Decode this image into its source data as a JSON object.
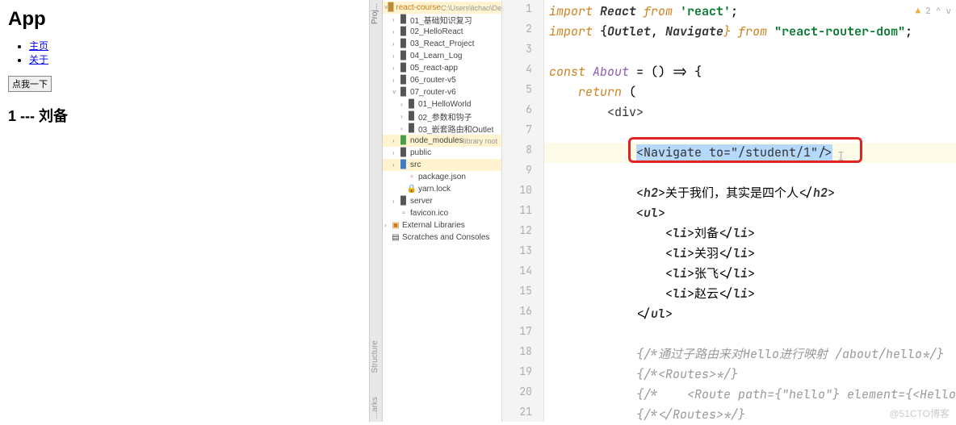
{
  "browser": {
    "title": "App",
    "nav": [
      "主页",
      "关于"
    ],
    "button": "点我一下",
    "content": "1 --- 刘备"
  },
  "ideTabs": {
    "top": "Proj...",
    "structure": "Structure",
    "bookmarks": "...arks"
  },
  "tree": [
    {
      "d": 0,
      "arrow": "v",
      "icon": "folder",
      "cls": "folder-icon",
      "label": "react-course",
      "suffix": " C:\\Users\\lichao\\De",
      "labelCls": "orange-txt",
      "selected": true
    },
    {
      "d": 1,
      "arrow": ">",
      "icon": "folder",
      "cls": "folder-dark",
      "label": "01_基础知识复习"
    },
    {
      "d": 1,
      "arrow": ">",
      "icon": "folder",
      "cls": "folder-dark",
      "label": "02_HelloReact"
    },
    {
      "d": 1,
      "arrow": ">",
      "icon": "folder",
      "cls": "folder-dark",
      "label": "03_React_Project"
    },
    {
      "d": 1,
      "arrow": ">",
      "icon": "folder",
      "cls": "folder-dark",
      "label": "04_Learn_Log"
    },
    {
      "d": 1,
      "arrow": ">",
      "icon": "folder",
      "cls": "folder-dark",
      "label": "05_react-app"
    },
    {
      "d": 1,
      "arrow": ">",
      "icon": "folder",
      "cls": "folder-dark",
      "label": "06_router-v5"
    },
    {
      "d": 1,
      "arrow": "v",
      "icon": "folder",
      "cls": "folder-dark",
      "label": "07_router-v6"
    },
    {
      "d": 2,
      "arrow": ">",
      "icon": "folder",
      "cls": "folder-dark",
      "label": "01_HelloWorld"
    },
    {
      "d": 2,
      "arrow": ">",
      "icon": "folder",
      "cls": "folder-dark",
      "label": "02_参数和钩子"
    },
    {
      "d": 2,
      "arrow": ">",
      "icon": "folder",
      "cls": "folder-dark",
      "label": "03_嵌套路由和Outlet"
    },
    {
      "d": 1,
      "arrow": ">",
      "icon": "folder",
      "cls": "green-icon",
      "label": "node_modules",
      "suffix": " library root",
      "selected": true,
      "labelCls": ""
    },
    {
      "d": 1,
      "arrow": ">",
      "icon": "folder",
      "cls": "folder-dark",
      "label": "public"
    },
    {
      "d": 1,
      "arrow": ">",
      "icon": "folder",
      "cls": "blue-icon",
      "label": "src",
      "selected": true
    },
    {
      "d": 2,
      "arrow": "",
      "icon": "file",
      "cls": "red-icon",
      "label": "package.json"
    },
    {
      "d": 2,
      "arrow": "",
      "icon": "lock",
      "cls": "red-icon",
      "label": "yarn.lock"
    },
    {
      "d": 1,
      "arrow": ">",
      "icon": "folder",
      "cls": "folder-dark",
      "label": "server"
    },
    {
      "d": 1,
      "arrow": "",
      "icon": "file",
      "cls": "blue-icon",
      "label": "favicon.ico"
    },
    {
      "d": 0,
      "arrow": ">",
      "icon": "lib",
      "cls": "orange-txt",
      "label": "External Libraries"
    },
    {
      "d": 0,
      "arrow": "",
      "icon": "scratch",
      "cls": "",
      "label": "Scratches and Consoles"
    }
  ],
  "gutter": [
    1,
    2,
    3,
    4,
    5,
    6,
    7,
    8,
    9,
    10,
    11,
    12,
    13,
    14,
    15,
    16,
    17,
    18,
    19,
    20,
    21
  ],
  "code": {
    "l1": {
      "a": "import ",
      "b": "React",
      "c": " from ",
      "d": "'react'",
      "e": ";"
    },
    "l2": {
      "a": "import ",
      "b": "{",
      "c": "Outlet",
      "d": ", ",
      "e": "Navigate",
      "f": "} from ",
      "g": "\"react-router-dom\"",
      "h": ";"
    },
    "l4": {
      "a": "const ",
      "b": "About",
      "c": " = () => {"
    },
    "l5": {
      "a": "    ",
      "b": "return ",
      "c": "("
    },
    "l6": "        <div>",
    "l8": {
      "pre": "            ",
      "sel": "<Navigate to=\"/student/1\"/>"
    },
    "l10": {
      "a": "            <",
      "b": "h2",
      "c": ">关于我们，其实是四个人</",
      "d": "h2",
      "e": ">"
    },
    "l11": {
      "a": "            <",
      "b": "ul",
      "c": ">"
    },
    "l12": {
      "a": "                <",
      "b": "li",
      "c": ">刘备</",
      "d": "li",
      "e": ">"
    },
    "l13": {
      "a": "                <",
      "b": "li",
      "c": ">关羽</",
      "d": "li",
      "e": ">"
    },
    "l14": {
      "a": "                <",
      "b": "li",
      "c": ">张飞</",
      "d": "li",
      "e": ">"
    },
    "l15": {
      "a": "                <",
      "b": "li",
      "c": ">赵云</",
      "d": "li",
      "e": ">"
    },
    "l16": {
      "a": "            </",
      "b": "ul",
      "c": ">"
    },
    "l18": "            {/*通过子路由来对Hello进行映射 /about/hello*/}",
    "l19": "            {/*<Routes>*/}",
    "l20": "            {/*    <Route path={\"hello\"} element={<Hello",
    "l21": "            {/*</Routes>*/}"
  },
  "indicators": {
    "warning": "2",
    "up": "^",
    "down": "v"
  },
  "watermark": "@51CTO博客"
}
